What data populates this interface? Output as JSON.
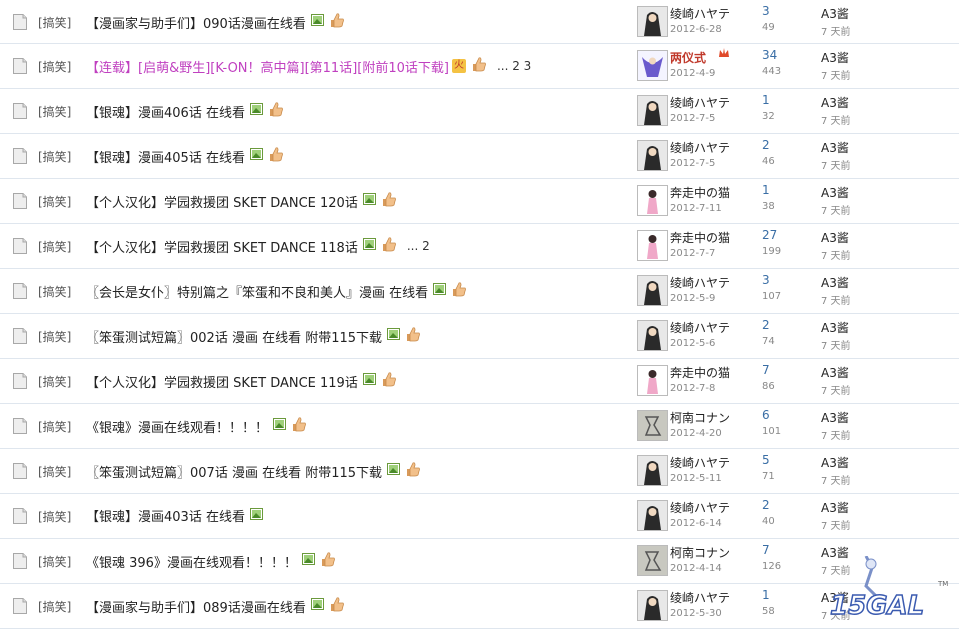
{
  "rows": [
    {
      "category": "[搞笑]",
      "title": "【漫画家与助手们】090话漫画在线看",
      "hot": false,
      "pages": "",
      "author": "绫崎ハヤテ",
      "author_red": false,
      "crown": false,
      "date": "2012-6-28",
      "replies": "3",
      "views": "49",
      "last_user": "A3酱",
      "last_time": "7 天前",
      "avatar": "dark"
    },
    {
      "category": "[搞笑]",
      "title": "【连载】[启萌&野生][K-ON！高中篇][第11话][附前10话下载]",
      "hot": true,
      "pages": "... 2  3",
      "author": "两仪式",
      "author_red": true,
      "crown": true,
      "date": "2012-4-9",
      "replies": "34",
      "views": "443",
      "last_user": "A3酱",
      "last_time": "7 天前",
      "avatar": "blue"
    },
    {
      "category": "[搞笑]",
      "title": "【银魂】漫画406话 在线看",
      "hot": false,
      "pages": "",
      "author": "绫崎ハヤテ",
      "author_red": false,
      "crown": false,
      "date": "2012-7-5",
      "replies": "1",
      "views": "32",
      "last_user": "A3酱",
      "last_time": "7 天前",
      "avatar": "dark"
    },
    {
      "category": "[搞笑]",
      "title": "【银魂】漫画405话 在线看",
      "hot": false,
      "pages": "",
      "author": "绫崎ハヤテ",
      "author_red": false,
      "crown": false,
      "date": "2012-7-5",
      "replies": "2",
      "views": "46",
      "last_user": "A3酱",
      "last_time": "7 天前",
      "avatar": "dark"
    },
    {
      "category": "[搞笑]",
      "title": "【个人汉化】学园救援团 SKET DANCE 120话",
      "hot": false,
      "pages": "",
      "author": "奔走中の猫",
      "author_red": false,
      "crown": false,
      "date": "2012-7-11",
      "replies": "1",
      "views": "38",
      "last_user": "A3酱",
      "last_time": "7 天前",
      "avatar": "pink"
    },
    {
      "category": "[搞笑]",
      "title": "【个人汉化】学园救援团 SKET DANCE 118话",
      "hot": false,
      "pages": "... 2",
      "author": "奔走中の猫",
      "author_red": false,
      "crown": false,
      "date": "2012-7-7",
      "replies": "27",
      "views": "199",
      "last_user": "A3酱",
      "last_time": "7 天前",
      "avatar": "pink"
    },
    {
      "category": "[搞笑]",
      "title": "〖会长是女仆〗特别篇之『笨蛋和不良和美人』漫画 在线看",
      "hot": false,
      "pages": "",
      "author": "绫崎ハヤテ",
      "author_red": false,
      "crown": false,
      "date": "2012-5-9",
      "replies": "3",
      "views": "107",
      "last_user": "A3酱",
      "last_time": "7 天前",
      "avatar": "dark"
    },
    {
      "category": "[搞笑]",
      "title": "〖笨蛋测试短篇〗002话 漫画 在线看 附带115下载",
      "hot": false,
      "pages": "",
      "author": "绫崎ハヤテ",
      "author_red": false,
      "crown": false,
      "date": "2012-5-6",
      "replies": "2",
      "views": "74",
      "last_user": "A3酱",
      "last_time": "7 天前",
      "avatar": "dark"
    },
    {
      "category": "[搞笑]",
      "title": "【个人汉化】学园救援团 SKET DANCE 119话",
      "hot": false,
      "pages": "",
      "author": "奔走中の猫",
      "author_red": false,
      "crown": false,
      "date": "2012-7-8",
      "replies": "7",
      "views": "86",
      "last_user": "A3酱",
      "last_time": "7 天前",
      "avatar": "pink"
    },
    {
      "category": "[搞笑]",
      "title": "《银魂》漫画在线观看！！！！",
      "hot": false,
      "pages": "",
      "author": "柯南コナン",
      "author_red": false,
      "crown": false,
      "date": "2012-4-20",
      "replies": "6",
      "views": "101",
      "last_user": "A3酱",
      "last_time": "7 天前",
      "avatar": "gray"
    },
    {
      "category": "[搞笑]",
      "title": "〖笨蛋测试短篇〗007话 漫画 在线看 附带115下载",
      "hot": false,
      "pages": "",
      "author": "绫崎ハヤテ",
      "author_red": false,
      "crown": false,
      "date": "2012-5-11",
      "replies": "5",
      "views": "71",
      "last_user": "A3酱",
      "last_time": "7 天前",
      "avatar": "dark"
    },
    {
      "category": "[搞笑]",
      "title": "【银魂】漫画403话 在线看",
      "hot": false,
      "pages": "",
      "author": "绫崎ハヤテ",
      "author_red": false,
      "crown": false,
      "date": "2012-6-14",
      "replies": "2",
      "views": "40",
      "last_user": "A3酱",
      "last_time": "7 天前",
      "avatar": "dark",
      "no_thumb": true
    },
    {
      "category": "[搞笑]",
      "title": "《银魂 396》漫画在线观看！！！！",
      "hot": false,
      "pages": "",
      "author": "柯南コナン",
      "author_red": false,
      "crown": false,
      "date": "2012-4-14",
      "replies": "7",
      "views": "126",
      "last_user": "A3酱",
      "last_time": "7 天前",
      "avatar": "gray"
    },
    {
      "category": "[搞笑]",
      "title": "【漫画家与助手们】089话漫画在线看",
      "hot": false,
      "pages": "",
      "author": "绫崎ハヤテ",
      "author_red": false,
      "crown": false,
      "date": "2012-5-30",
      "replies": "1",
      "views": "58",
      "last_user": "A3酱",
      "last_time": "7 天前",
      "avatar": "dark"
    }
  ],
  "logo": {
    "text": "15GAL",
    "tm": "TM"
  },
  "colors": {
    "hot_title": "#c040c0",
    "reply_count": "#3a6ea5",
    "divider": "#dfe6ee"
  }
}
